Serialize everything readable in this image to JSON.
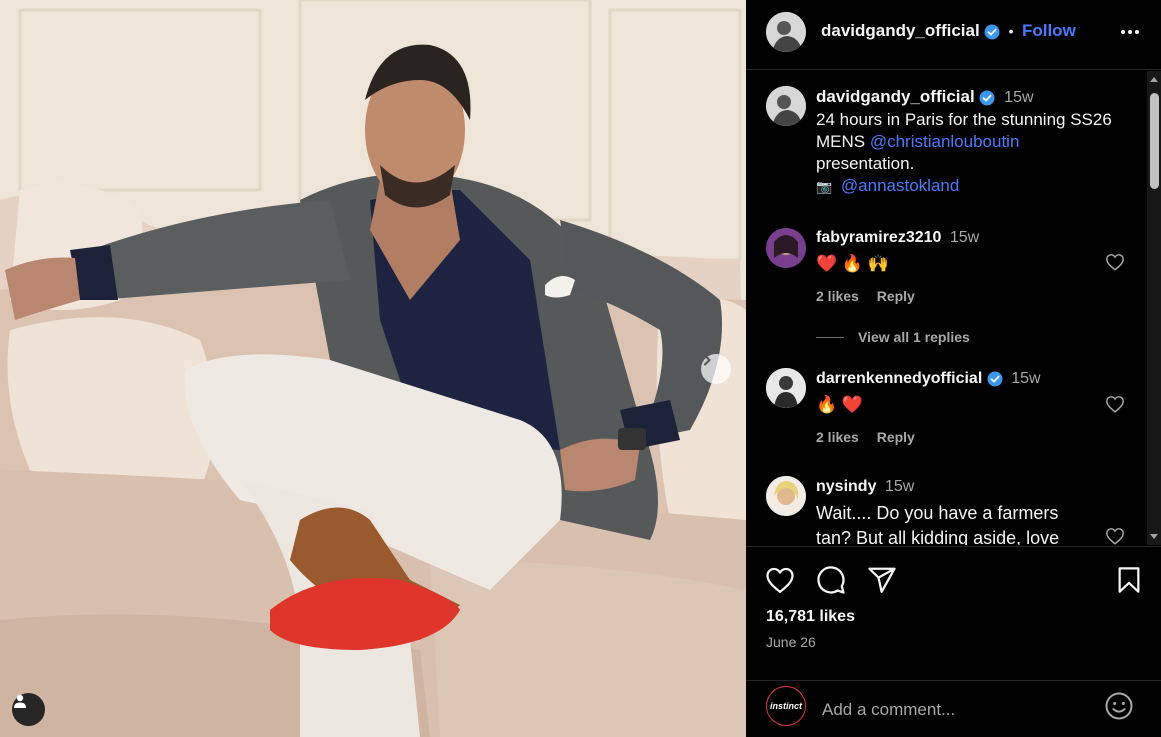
{
  "post": {
    "username": "davidgandy_official",
    "follow_label": "Follow",
    "separator": "•"
  },
  "caption": {
    "username": "davidgandy_official",
    "time": "15w",
    "text_before": "24 hours in Paris for the stunning SS26 MENS ",
    "mention1": "@christianlouboutin",
    "text_after": "presentation.",
    "camera_emoji": "📷",
    "mention2": "@annastokland"
  },
  "comments": [
    {
      "username": "fabyramirez3210",
      "time": "15w",
      "text": "❤️ 🔥 🙌",
      "likes": "2 likes",
      "reply": "Reply",
      "view_replies": "View all 1 replies"
    },
    {
      "username": "darrenkennedyofficial",
      "time": "15w",
      "text": "🔥 ❤️",
      "likes": "2 likes",
      "reply": "Reply"
    },
    {
      "username": "nysindy",
      "time": "15w",
      "text": "Wait.... Do you have a farmers tan? But all kidding aside, love"
    }
  ],
  "stats": {
    "likes": "16,781 likes",
    "date": "June 26"
  },
  "add_comment": {
    "placeholder": "Add a comment...",
    "avatar_text": "instinct"
  },
  "colors": {
    "accent": "#4a7bff",
    "verified": "#3897f0",
    "background": "#000000",
    "muted": "#a8a8a8"
  }
}
